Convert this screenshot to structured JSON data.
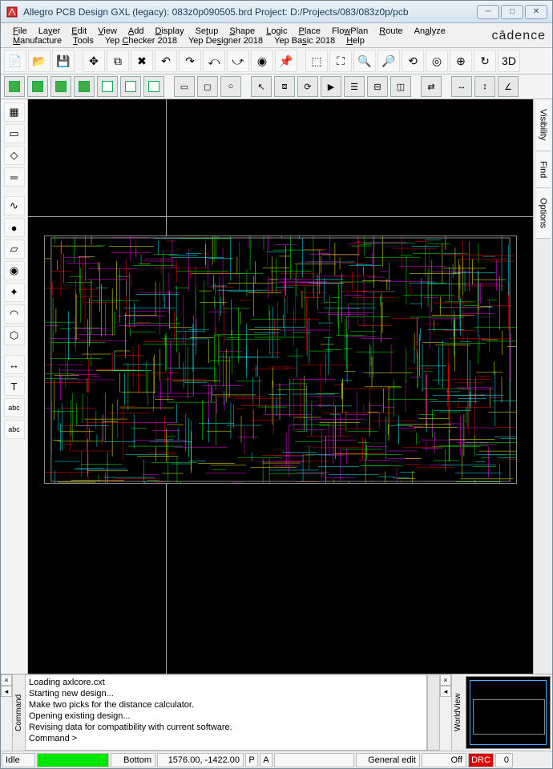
{
  "title": "Allegro PCB Design GXL (legacy): 083z0p090505.brd  Project: D:/Projects/083/083z0p/pcb",
  "brand": "cādence",
  "menus": [
    "File",
    "Layer",
    "Edit",
    "View",
    "Add",
    "Display",
    "Setup",
    "Shape",
    "Logic",
    "Place",
    "FlowPlan",
    "Route",
    "Analyze",
    "Manufacture",
    "Tools",
    "Yep Checker 2018",
    "Yep Designer 2018",
    "Yep Basic 2018",
    "Help"
  ],
  "menu_underline_idx": [
    0,
    2,
    0,
    0,
    0,
    0,
    2,
    0,
    0,
    0,
    3,
    0,
    2,
    0,
    0,
    4,
    6,
    6,
    0
  ],
  "toolbar1_icons": [
    "new",
    "open",
    "save",
    "",
    "move",
    "copy",
    "delete",
    "undo",
    "redo",
    "undo2",
    "redo2",
    "marker",
    "pin",
    "",
    "zoom-window",
    "zoom-fit",
    "zoom-in",
    "zoom-out",
    "zoom-prev",
    "zoom-sel",
    "zoom-center",
    "refresh",
    "3d"
  ],
  "toolbar2_icons": [
    "rat-all",
    "rat-comp",
    "rat-net",
    "rat-off",
    "unrat-all",
    "unrat-comp",
    "unrat-net",
    "",
    "sel",
    "area",
    "circle",
    "",
    "cursor",
    "group",
    "repeat",
    "go",
    "layers",
    "sub",
    "shadow",
    "",
    "swap",
    "",
    "dim-h",
    "dim-v",
    "dim-ang"
  ],
  "left_tools": [
    "comp",
    "ic",
    "sot",
    "res",
    "",
    "trace",
    "via",
    "shape",
    "pad",
    "flash",
    "arc",
    "poly",
    "",
    "dim",
    "text",
    "abc",
    "abc2"
  ],
  "right_tabs": [
    "Visibility",
    "Find",
    "Options"
  ],
  "console_label": "Command",
  "console_lines": [
    "Loading axlcore.cxt",
    "Starting new design...",
    "Make two picks for the distance calculator.",
    "Opening existing design...",
    "Revising data for compatibility with current software.",
    "Command >"
  ],
  "worldview_label": "WorldView",
  "status": {
    "mode": "Idle",
    "layer": "Bottom",
    "coords": "1576.00, -1422.00",
    "p": "P",
    "a": "A",
    "app_mode": "General edit",
    "grid": "Off",
    "drc": "DRC",
    "count": "0"
  }
}
